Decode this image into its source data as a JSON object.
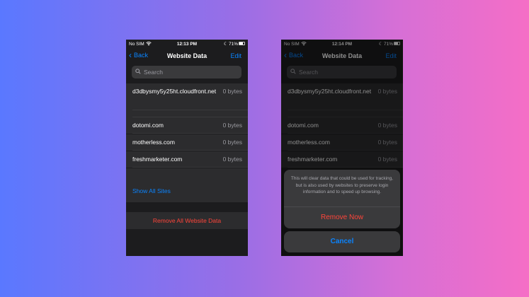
{
  "left_phone": {
    "status": {
      "carrier": "No SIM",
      "time": "12:13 PM",
      "battery": "71%"
    },
    "nav": {
      "back_label": "Back",
      "title": "Website Data",
      "edit_label": "Edit"
    },
    "search": {
      "placeholder": "Search"
    },
    "rows": [
      {
        "domain": "d3dbysmy5y25ht.cloudfront.net",
        "size": "0 bytes"
      },
      {
        "domain": "dotomi.com",
        "size": "0 bytes"
      },
      {
        "domain": "motherless.com",
        "size": "0 bytes"
      },
      {
        "domain": "freshmarketer.com",
        "size": "0 bytes"
      }
    ],
    "show_all_label": "Show All Sites",
    "remove_all_label": "Remove All Website Data"
  },
  "right_phone": {
    "status": {
      "carrier": "No SIM",
      "time": "12:14 PM",
      "battery": "71%"
    },
    "nav": {
      "back_label": "Back",
      "title": "Website Data",
      "edit_label": "Edit"
    },
    "search": {
      "placeholder": "Search"
    },
    "rows": [
      {
        "domain": "d3dbysmy5y25ht.cloudfront.net",
        "size": "0 bytes"
      },
      {
        "domain": "dotomi.com",
        "size": "0 bytes"
      },
      {
        "domain": "motherless.com",
        "size": "0 bytes"
      },
      {
        "domain": "freshmarketer.com",
        "size": "0 bytes"
      }
    ],
    "action_sheet": {
      "message": "This will clear data that could be used for tracking, but is also used by websites to preserve login information and to speed up browsing.",
      "confirm_label": "Remove Now",
      "cancel_label": "Cancel"
    }
  },
  "colors": {
    "accent": "#0a84ff",
    "destructive": "#ff453a",
    "background_gradient_start": "#5a78ff",
    "background_gradient_end": "#f56ec6"
  },
  "icons": [
    "wifi-icon",
    "moon-icon",
    "battery-icon",
    "chevron-left-icon",
    "search-icon"
  ]
}
